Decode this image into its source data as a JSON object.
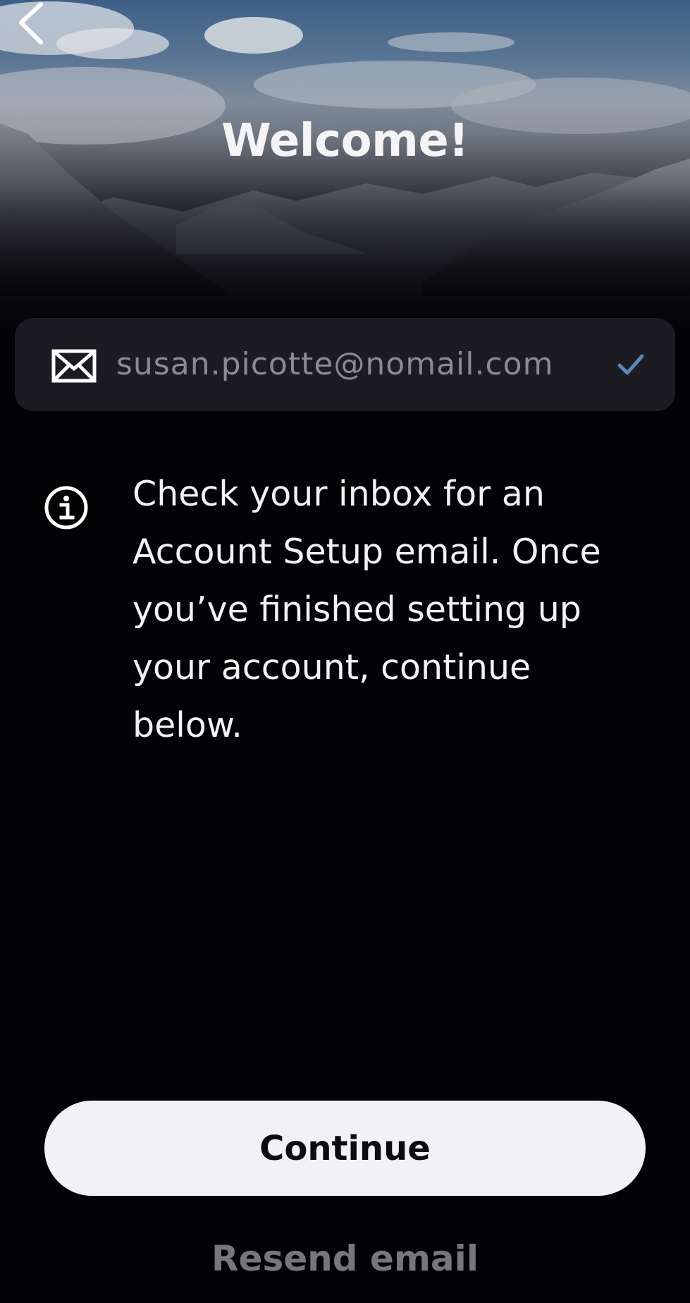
{
  "header": {
    "title": "Welcome!",
    "back_icon": "chevron-left-icon"
  },
  "email_field": {
    "value": "susan.picotte@nomail.com",
    "leading_icon": "mail-icon",
    "status_icon": "check-icon",
    "status_color": "#5b86b8"
  },
  "info": {
    "icon": "info-icon",
    "message": "Check your inbox for an Account Setup email. Once you’ve finished setting up your account, continue below."
  },
  "actions": {
    "continue_label": "Continue",
    "resend_label": "Resend email"
  },
  "colors": {
    "background": "#030205",
    "field_background": "#1c1b21",
    "primary_button": "#f2f1f6",
    "secondary_text": "#77767c"
  }
}
